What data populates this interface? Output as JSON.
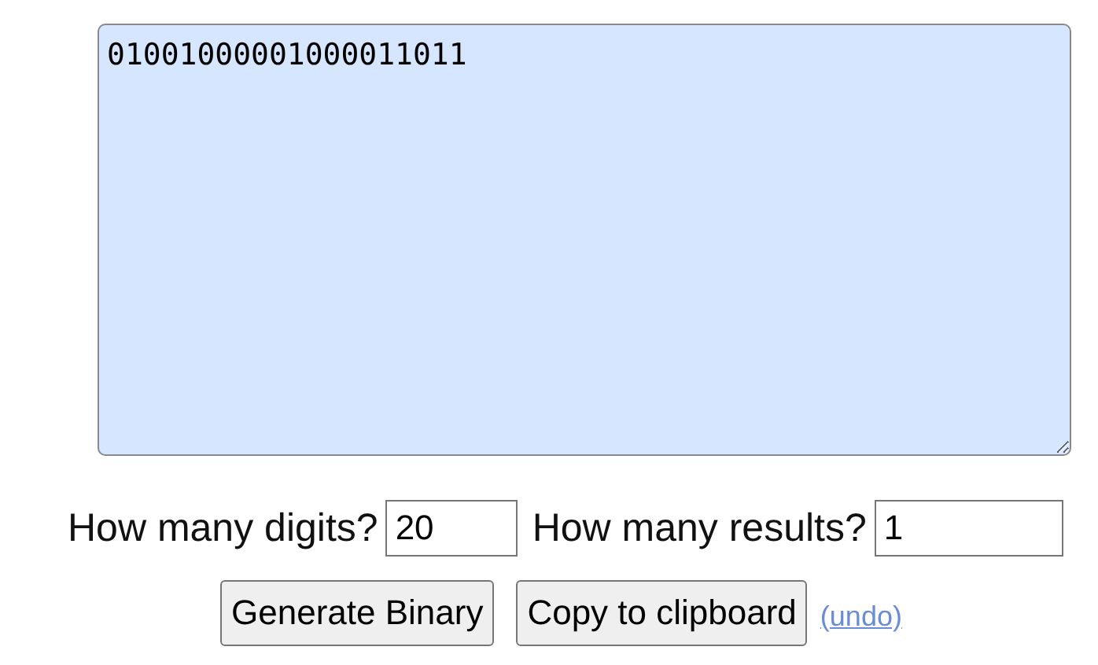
{
  "output": {
    "value": "01001000001000011011"
  },
  "options": [
    {
      "label": "How many digits?",
      "value": "20"
    },
    {
      "label": "How many results?",
      "value": "1"
    }
  ],
  "buttons": [
    "Generate Binary",
    "Copy to clipboard"
  ],
  "undo_link": "(undo)"
}
